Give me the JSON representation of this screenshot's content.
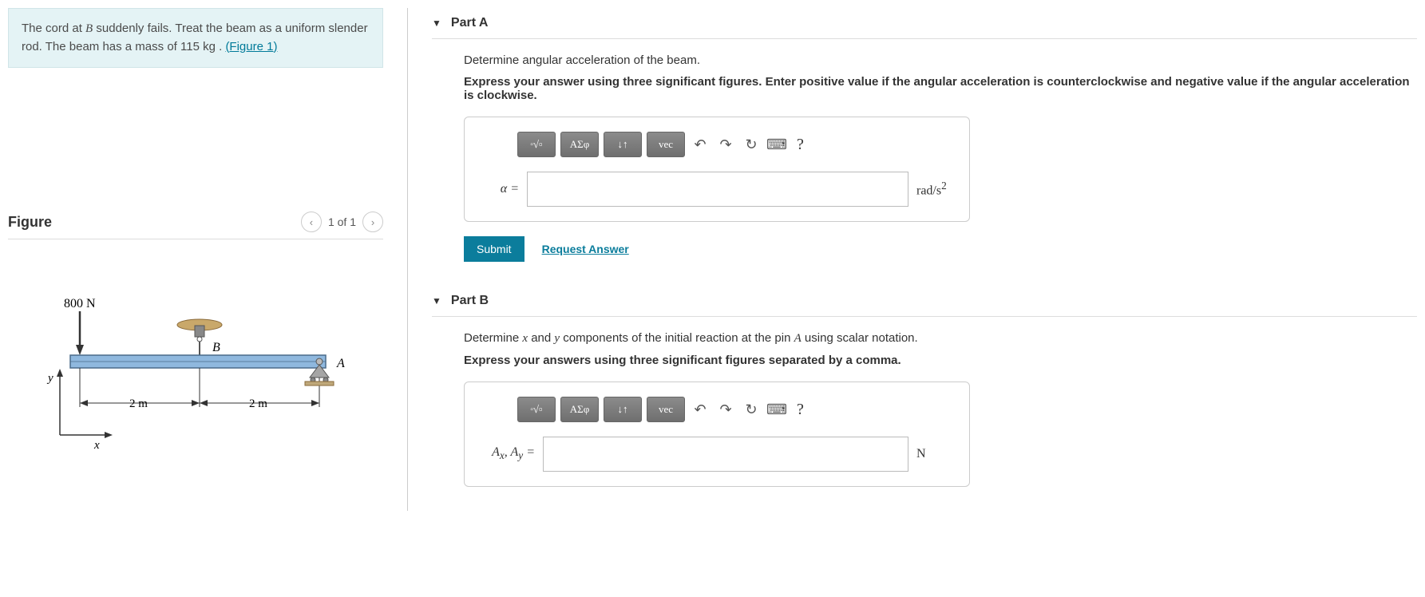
{
  "problem": {
    "text_before_B": "The cord at ",
    "B": "B",
    "text_after_B": " suddenly fails. Treat the beam as a uniform slender rod. The beam has a mass of 115 ",
    "unit": "kg",
    "period": " . ",
    "figure_link": "(Figure 1)"
  },
  "figure": {
    "title": "Figure",
    "pager": "1 of 1",
    "load_label": "800 N",
    "dim1": "2 m",
    "dim2": "2 m",
    "x": "x",
    "y": "y",
    "A": "A",
    "B": "B"
  },
  "partA": {
    "title": "Part A",
    "prompt": "Determine angular acceleration of the beam.",
    "instruction": "Express your answer using three significant figures. Enter positive value if the angular acceleration is counterclockwise and negative value if the angular acceleration is clockwise.",
    "var": "α =",
    "unit": "rad/s²",
    "submit": "Submit",
    "request": "Request Answer"
  },
  "partB": {
    "title": "Part B",
    "prompt_before": "Determine ",
    "x": "x",
    "and": " and ",
    "y": "y",
    "prompt_mid": " components of the initial reaction at the pin ",
    "A": "A",
    "prompt_after": " using scalar notation.",
    "instruction": "Express your answers using three significant figures separated by a comma.",
    "var": "Aₓ, Aᵧ =",
    "unit": "N"
  },
  "toolbar": {
    "templates": "▮√▯",
    "greek": "ΑΣφ",
    "subsup": "↓↑",
    "vec": "vec",
    "undo": "↶",
    "redo": "↷",
    "reset": "↻",
    "keyboard": "⌨",
    "help": "?"
  }
}
